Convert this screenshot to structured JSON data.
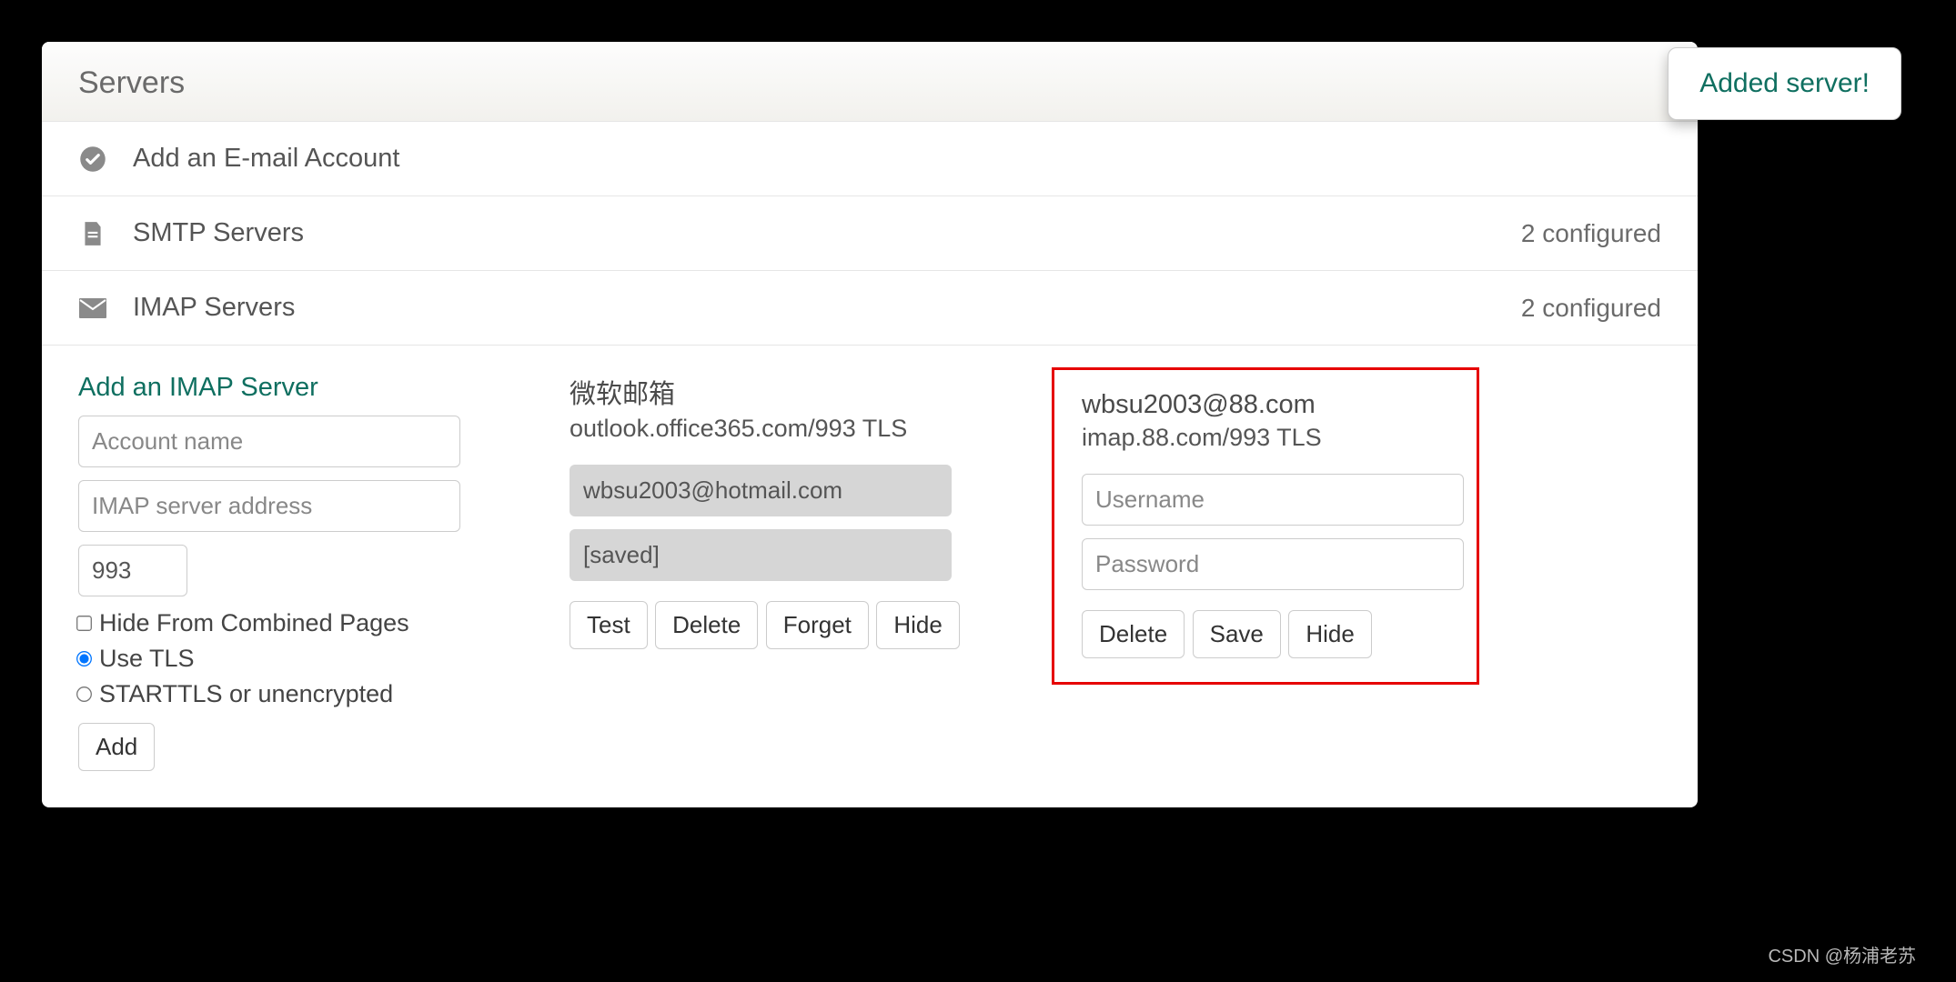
{
  "header": {
    "title": "Servers"
  },
  "toast": {
    "message": "Added server!"
  },
  "rows": {
    "add_account": {
      "label": "Add an E-mail Account"
    },
    "smtp": {
      "label": "SMTP Servers",
      "status": "2 configured"
    },
    "imap": {
      "label": "IMAP Servers",
      "status": "2 configured"
    }
  },
  "add_form": {
    "title": "Add an IMAP Server",
    "name_placeholder": "Account name",
    "addr_placeholder": "IMAP server address",
    "port_value": "993",
    "hide_label": "Hide From Combined Pages",
    "tls_label": "Use TLS",
    "starttls_label": "STARTTLS or unencrypted",
    "add_button": "Add"
  },
  "server1": {
    "title": "微软邮箱",
    "sub": "outlook.office365.com/993 TLS",
    "username": "wbsu2003@hotmail.com",
    "password": "[saved]",
    "buttons": {
      "test": "Test",
      "delete": "Delete",
      "forget": "Forget",
      "hide": "Hide"
    }
  },
  "server2": {
    "title": "wbsu2003@88.com",
    "sub": "imap.88.com/993 TLS",
    "username_placeholder": "Username",
    "password_placeholder": "Password",
    "buttons": {
      "delete": "Delete",
      "save": "Save",
      "hide": "Hide"
    }
  },
  "watermark": "CSDN @杨浦老苏"
}
